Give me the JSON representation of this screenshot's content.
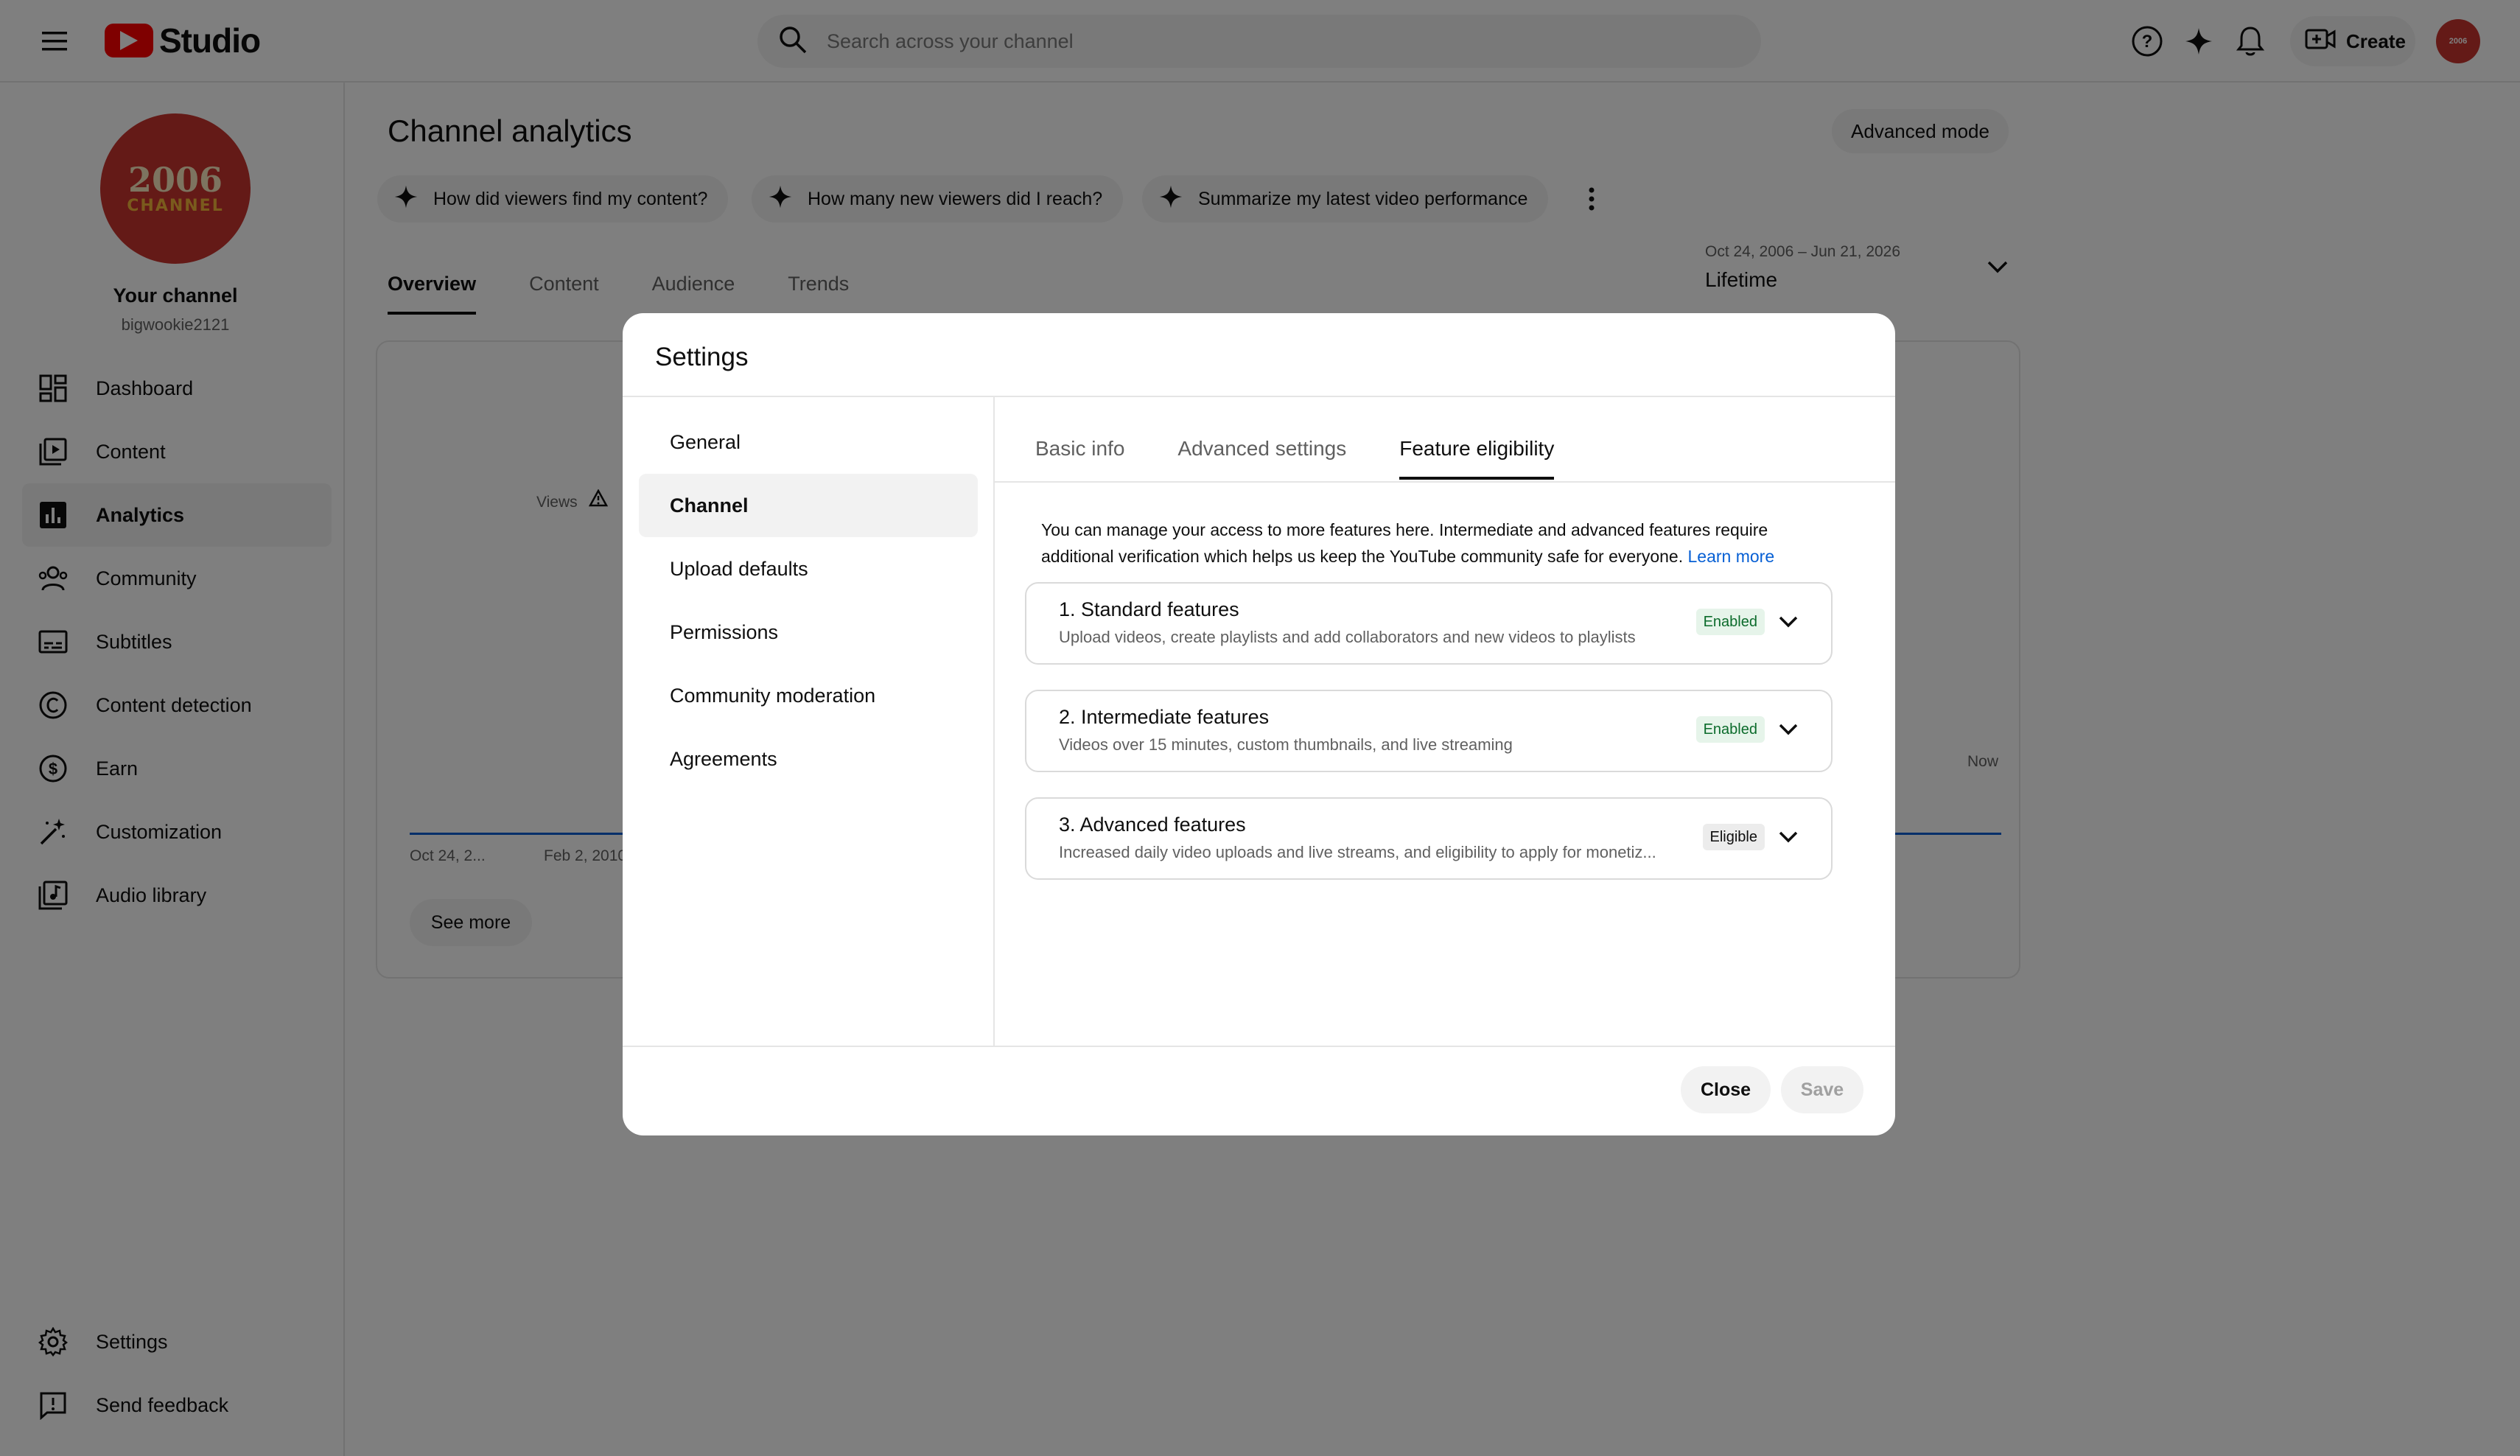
{
  "header": {
    "logo_text": "Studio",
    "search_placeholder": "Search across your channel",
    "create_label": "Create"
  },
  "channel": {
    "avatar_line1": "2006",
    "avatar_line2": "CHANNEL",
    "name": "Your channel",
    "handle": "bigwookie2121"
  },
  "sidebar": {
    "items": [
      {
        "label": "Dashboard",
        "icon": "dashboard-icon"
      },
      {
        "label": "Content",
        "icon": "content-icon"
      },
      {
        "label": "Analytics",
        "icon": "analytics-icon"
      },
      {
        "label": "Community",
        "icon": "community-icon"
      },
      {
        "label": "Subtitles",
        "icon": "subtitles-icon"
      },
      {
        "label": "Content detection",
        "icon": "copyright-icon"
      },
      {
        "label": "Earn",
        "icon": "dollar-icon"
      },
      {
        "label": "Customization",
        "icon": "magic-wand-icon"
      },
      {
        "label": "Audio library",
        "icon": "audio-library-icon"
      }
    ],
    "settings_label": "Settings",
    "feedback_label": "Send feedback"
  },
  "analytics": {
    "title": "Channel analytics",
    "advanced_mode": "Advanced mode",
    "chips": [
      "How did viewers find my content?",
      "How many new viewers did I reach?",
      "Summarize my latest video performance"
    ],
    "tabs": [
      "Overview",
      "Content",
      "Audience",
      "Trends"
    ],
    "date_range": "Oct 24, 2006 – Jun 21, 2026",
    "date_period": "Lifetime",
    "views_label": "Views",
    "x_label_1": "Oct 24, 2...",
    "x_label_2": "Feb 2, 2010",
    "x_label_now": "Now",
    "see_more": "See more"
  },
  "dialog": {
    "title": "Settings",
    "nav": [
      "General",
      "Channel",
      "Upload defaults",
      "Permissions",
      "Community moderation",
      "Agreements"
    ],
    "tabs": [
      "Basic info",
      "Advanced settings",
      "Feature eligibility"
    ],
    "intro_text": "You can manage your access to more features here. Intermediate and advanced features require additional verification which helps us keep the YouTube community safe for everyone.",
    "learn_more": "Learn more",
    "features": [
      {
        "title": "1. Standard features",
        "desc": "Upload videos, create playlists and add collaborators and new videos to playlists",
        "status": "Enabled"
      },
      {
        "title": "2. Intermediate features",
        "desc": "Videos over 15 minutes, custom thumbnails, and live streaming",
        "status": "Enabled"
      },
      {
        "title": "3. Advanced features",
        "desc": "Increased daily video uploads and live streams, and eligibility to apply for monetiz...",
        "status": "Eligible"
      }
    ],
    "close_label": "Close",
    "save_label": "Save"
  },
  "colors": {
    "brand_red": "#ff0000",
    "link_blue": "#065fd4",
    "enabled_green": "#0b6b2b"
  }
}
